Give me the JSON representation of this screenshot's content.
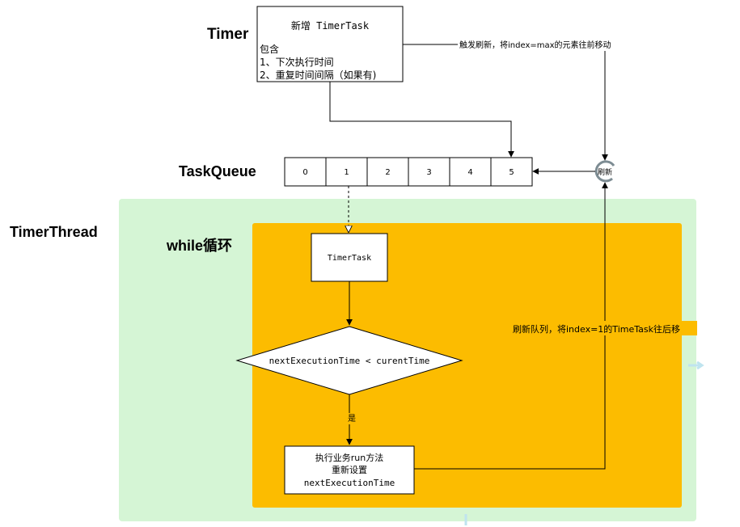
{
  "labels": {
    "timer": "Timer",
    "task_queue": "TaskQueue",
    "timer_thread": "TimerThread",
    "while_loop": "while循环"
  },
  "new_task_box": {
    "title": "新增 TimerTask",
    "line1": "包含",
    "line2": "1、下次执行时间",
    "line3": "2、重复时间间隔（如果有)"
  },
  "queue_cells": [
    "0",
    "1",
    "2",
    "3",
    "4",
    "5"
  ],
  "refresh_node": "刷新",
  "edge_labels": {
    "refresh_up": "触发刷新，将index=max的元素往前移动",
    "refresh_down": "刷新队列，将index=1的TimeTask往后移",
    "yes": "是"
  },
  "timer_task_box": "TimerTask",
  "decision": "nextExecutionTime < curentTime",
  "action_box": {
    "line1": "执行业务run方法",
    "line2": "重新设置",
    "line3": "nextExecutionTime"
  },
  "colors": {
    "thread_bg": "#d5f5d5",
    "loop_bg": "#fcbc00",
    "stroke": "#000000",
    "accent": "#bfe4ef"
  }
}
